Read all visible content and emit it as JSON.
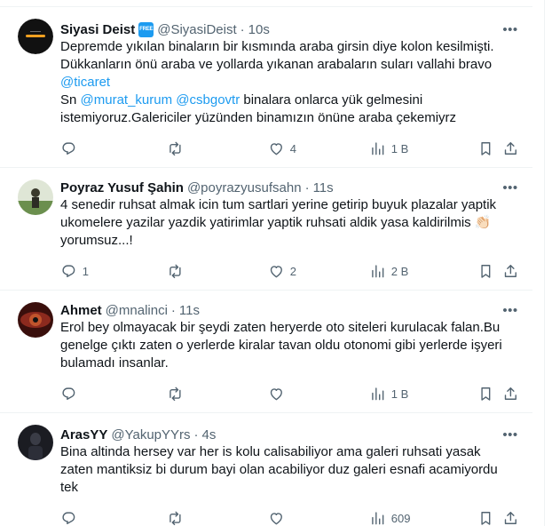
{
  "tweets": [
    {
      "name": "Siyasi Deist",
      "badge": "FREE",
      "handle": "@SiyasiDeist",
      "time": "10s",
      "lines": [
        [
          {
            "t": "Depremde yıkılan binaların bir kısmında araba girsin diye kolon kesilmişti."
          }
        ],
        [
          {
            "t": "Dükkanların önü araba ve yollarda yıkanan arabaların suları vallahi bravo"
          }
        ],
        [
          {
            "t": "@ticaret",
            "m": true
          }
        ],
        [
          {
            "t": "Sn "
          },
          {
            "t": "@murat_kurum",
            "m": true
          },
          {
            "t": " "
          },
          {
            "t": "@csbgovtr",
            "m": true
          },
          {
            "t": " binalara onlarca yük gelmesini"
          }
        ],
        [
          {
            "t": "istemiyoruz.Galericiler yüzünden binamızın önüne araba çekemiyrz"
          }
        ]
      ],
      "replies": "",
      "reposts": "",
      "likes": "4",
      "views": "1 B"
    },
    {
      "name": "Poyraz Yusuf Şahin",
      "handle": "@poyrazyusufsahn",
      "time": "11s",
      "lines": [
        [
          {
            "t": "4 senedir ruhsat almak icin tum sartlari yerine getirip buyuk plazalar yaptik"
          }
        ],
        [
          {
            "t": "ukomelere yazilar yazdik yatirimlar yaptik ruhsati aldik yasa kaldirilmis 👏🏻"
          }
        ],
        [
          {
            "t": "yorumsuz...!"
          }
        ]
      ],
      "replies": "1",
      "reposts": "",
      "likes": "2",
      "views": "2 B"
    },
    {
      "name": "Ahmet",
      "handle": "@mnalinci",
      "time": "11s",
      "lines": [
        [
          {
            "t": "Erol bey olmayacak bir şeydi zaten heryerde oto siteleri kurulacak falan.Bu"
          }
        ],
        [
          {
            "t": "genelge çıktı zaten o yerlerde kiralar tavan oldu otonomi gibi yerlerde işyeri"
          }
        ],
        [
          {
            "t": "bulamadı insanlar."
          }
        ]
      ],
      "replies": "",
      "reposts": "",
      "likes": "",
      "views": "1 B"
    },
    {
      "name": "ArasYY",
      "handle": "@YakupYYrs",
      "time": "4s",
      "lines": [
        [
          {
            "t": "Bina altinda hersey var  her is kolu calisabiliyor ama galeri ruhsati yasak"
          }
        ],
        [
          {
            "t": "zaten mantiksiz bi durum bayi olan acabiliyor duz galeri esnafi acamiyordu"
          }
        ],
        [
          {
            "t": "tek"
          }
        ]
      ],
      "replies": "",
      "reposts": "",
      "likes": "",
      "views": "609"
    }
  ]
}
